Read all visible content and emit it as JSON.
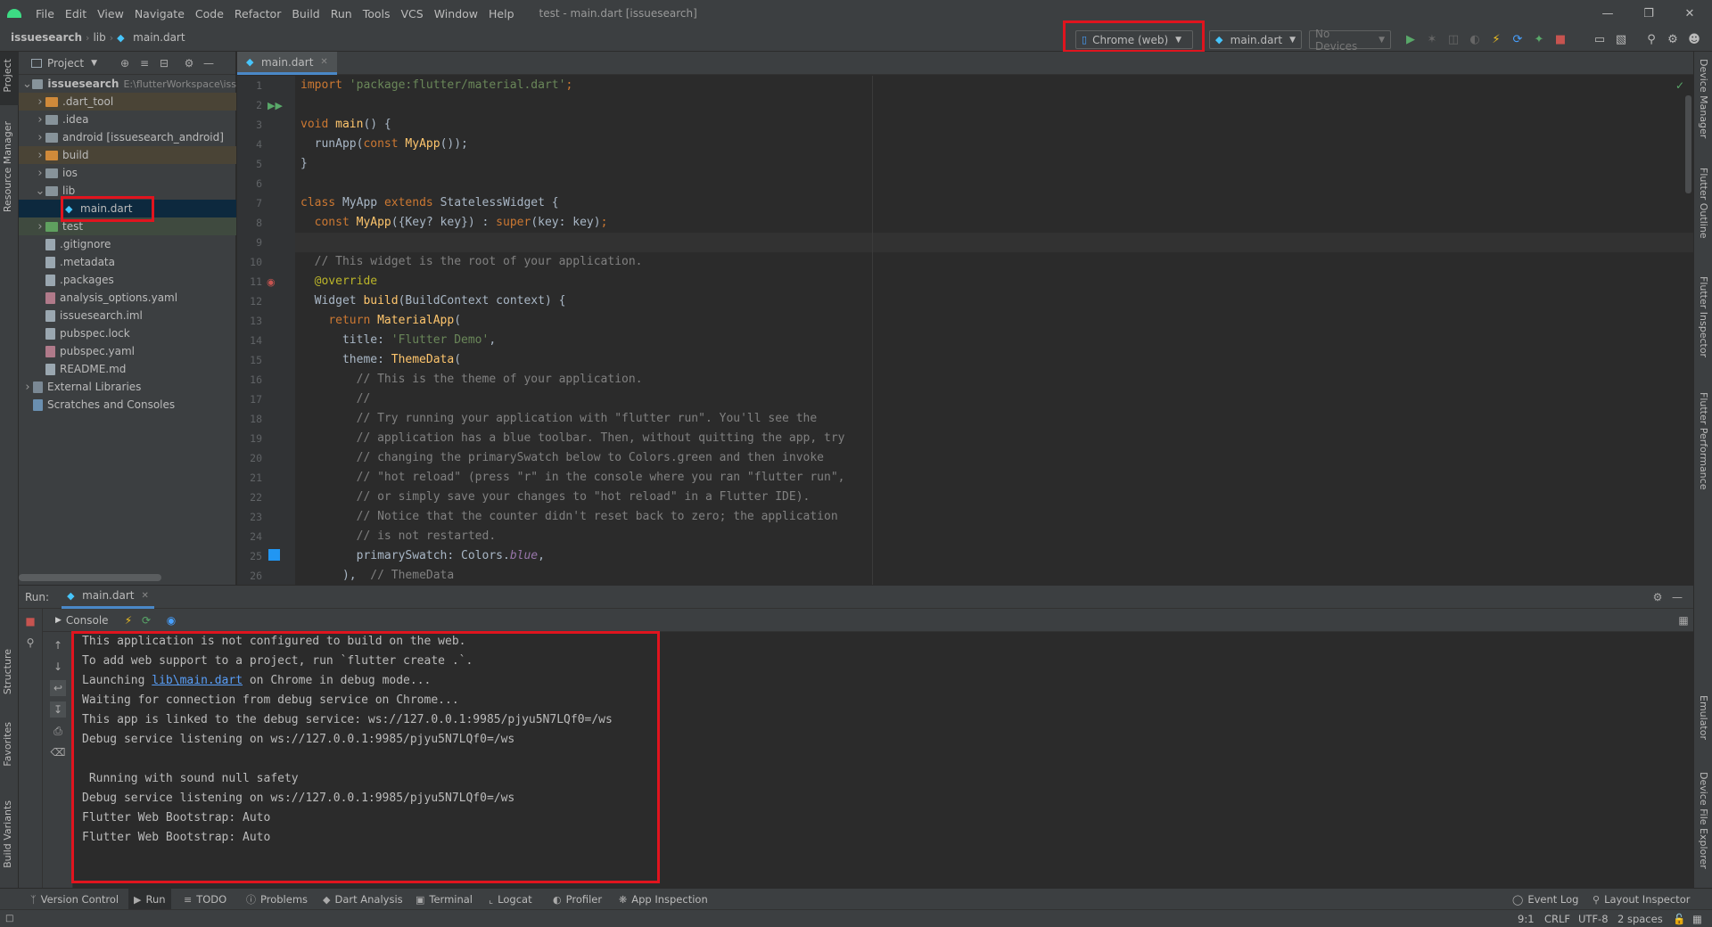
{
  "menubar": {
    "items": [
      "File",
      "Edit",
      "View",
      "Navigate",
      "Code",
      "Refactor",
      "Build",
      "Run",
      "Tools",
      "VCS",
      "Window",
      "Help"
    ],
    "title": "test - main.dart [issuesearch]"
  },
  "navbar": {
    "breadcrumb": [
      "issuesearch",
      "lib",
      "main.dart"
    ],
    "device_selector": "Chrome (web)",
    "run_config": "main.dart",
    "devices": "No Devices"
  },
  "project_panel": {
    "title": "Project",
    "tree": [
      {
        "label": "issuesearch",
        "extra": "E:\\flutterWorkspace\\iss",
        "kind": "root",
        "expanded": true
      },
      {
        "label": ".dart_tool",
        "kind": "folder-orange"
      },
      {
        "label": ".idea",
        "kind": "folder"
      },
      {
        "label": "android [issuesearch_android]",
        "kind": "folder"
      },
      {
        "label": "build",
        "kind": "folder-orange"
      },
      {
        "label": "ios",
        "kind": "folder"
      },
      {
        "label": "lib",
        "kind": "folder",
        "expanded": true
      },
      {
        "label": "main.dart",
        "kind": "dart",
        "selected": true
      },
      {
        "label": "test",
        "kind": "folder-green"
      },
      {
        "label": ".gitignore",
        "kind": "file"
      },
      {
        "label": ".metadata",
        "kind": "file"
      },
      {
        "label": ".packages",
        "kind": "file"
      },
      {
        "label": "analysis_options.yaml",
        "kind": "yaml"
      },
      {
        "label": "issuesearch.iml",
        "kind": "file"
      },
      {
        "label": "pubspec.lock",
        "kind": "file"
      },
      {
        "label": "pubspec.yaml",
        "kind": "yaml"
      },
      {
        "label": "README.md",
        "kind": "file"
      },
      {
        "label": "External Libraries",
        "kind": "lib"
      },
      {
        "label": "Scratches and Consoles",
        "kind": "scratch"
      }
    ]
  },
  "editor": {
    "tab": "main.dart",
    "line_numbers": [
      "1",
      "2",
      "3",
      "4",
      "5",
      "6",
      "7",
      "8",
      "9",
      "10",
      "11",
      "12",
      "13",
      "14",
      "15",
      "16",
      "17",
      "18",
      "19",
      "20",
      "21",
      "22",
      "23",
      "24",
      "25",
      "26"
    ]
  },
  "left_stripe": {
    "project": "Project",
    "resource_manager": "Resource Manager",
    "structure": "Structure",
    "favorites": "Favorites",
    "build_variants": "Build Variants"
  },
  "right_stripe": {
    "device_manager": "Device Manager",
    "flutter_outline": "Flutter Outline",
    "flutter_inspector": "Flutter Inspector",
    "flutter_performance": "Flutter Performance",
    "emulator": "Emulator",
    "device_file_explorer": "Device File Explorer"
  },
  "run_panel": {
    "label": "Run:",
    "tab": "main.dart",
    "console_tab": "Console",
    "lines": [
      "This application is not configured to build on the web.",
      "To add web support to a project, run `flutter create .`.",
      "Launching |lib\\main.dart| on Chrome in debug mode...",
      "Waiting for connection from debug service on Chrome...",
      "This app is linked to the debug service: ws://127.0.0.1:9985/pjyu5N7LQf0=/ws",
      "Debug service listening on ws://127.0.0.1:9985/pjyu5N7LQf0=/ws",
      "",
      " Running with sound null safety",
      "Debug service listening on ws://127.0.0.1:9985/pjyu5N7LQf0=/ws",
      "Flutter Web Bootstrap: Auto",
      "Flutter Web Bootstrap: Auto"
    ],
    "launch_prefix": "Launching ",
    "launch_link": "lib\\main.dart",
    "launch_suffix": " on Chrome in debug mode..."
  },
  "bottom_tools": [
    "Version Control",
    "Run",
    "TODO",
    "Problems",
    "Dart Analysis",
    "Terminal",
    "Logcat",
    "Profiler",
    "App Inspection"
  ],
  "bottom_right_tools": [
    "Event Log",
    "Layout Inspector"
  ],
  "status": {
    "position": "9:1",
    "line_sep": "CRLF",
    "encoding": "UTF-8",
    "indent": "2 spaces"
  },
  "colors": {
    "highlight_box": "#e0141e",
    "accent": "#4a88c7",
    "run_green": "#59a869",
    "stop_red": "#c75450"
  }
}
